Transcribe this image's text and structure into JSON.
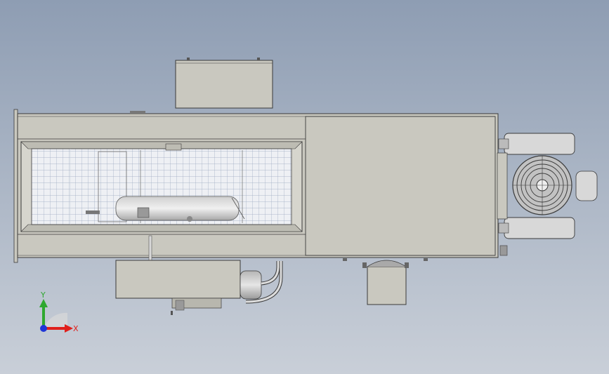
{
  "viewport": {
    "background_top": "#8e9db3",
    "background_bottom": "#c9cfd8"
  },
  "model": {
    "body_color": "#c9c8bf",
    "edge_color": "#3a3a3a",
    "grid_color": "#9aa7bf",
    "fan_color": "#c2c2c2"
  },
  "triad": {
    "x_label": "X",
    "y_label": "Y",
    "x_color": "#e0201b",
    "y_color": "#2fa82f",
    "z_color": "#1f35d6"
  }
}
